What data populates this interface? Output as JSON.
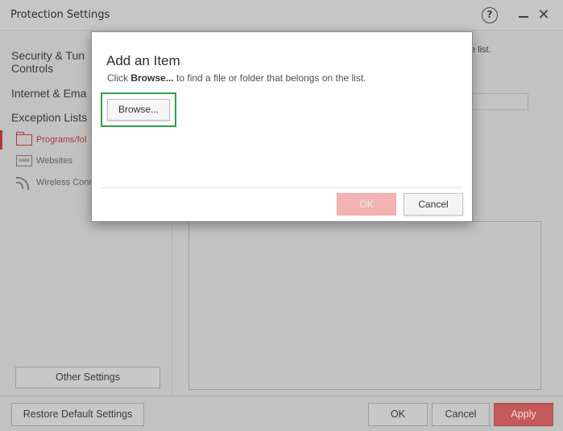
{
  "window": {
    "title": "Protection Settings",
    "help_glyph": "?",
    "close_glyph": "✕"
  },
  "sidebar": {
    "security_heading": "Security & Tun",
    "security_heading_line2": "Controls",
    "internet_heading": "Internet & Ema",
    "exception_heading": "Exception Lists",
    "items": [
      {
        "label": "Programs/fol",
        "icon": "folder-icon",
        "active": true
      },
      {
        "label": "Websites",
        "icon": "www-icon",
        "active": false
      },
      {
        "label": "Wireless Conn",
        "icon": "wifi-icon",
        "active": false
      }
    ],
    "www_icon_text": "www",
    "other_settings_label": "Other Settings"
  },
  "main": {
    "partial_text": "e list."
  },
  "footer": {
    "restore_label": "Restore Default Settings",
    "ok_label": "OK",
    "cancel_label": "Cancel",
    "apply_label": "Apply"
  },
  "dialog": {
    "title": "Add an Item",
    "instruction_prefix": "Click ",
    "instruction_bold": "Browse...",
    "instruction_suffix": " to find a file or folder that belongs on the list.",
    "browse_label": "Browse...",
    "ok_label": "OK",
    "cancel_label": "Cancel"
  },
  "colors": {
    "accent_red": "#c45a5a",
    "highlight_green": "#2e9e48",
    "disabled_ok": "#f4b3b3"
  }
}
